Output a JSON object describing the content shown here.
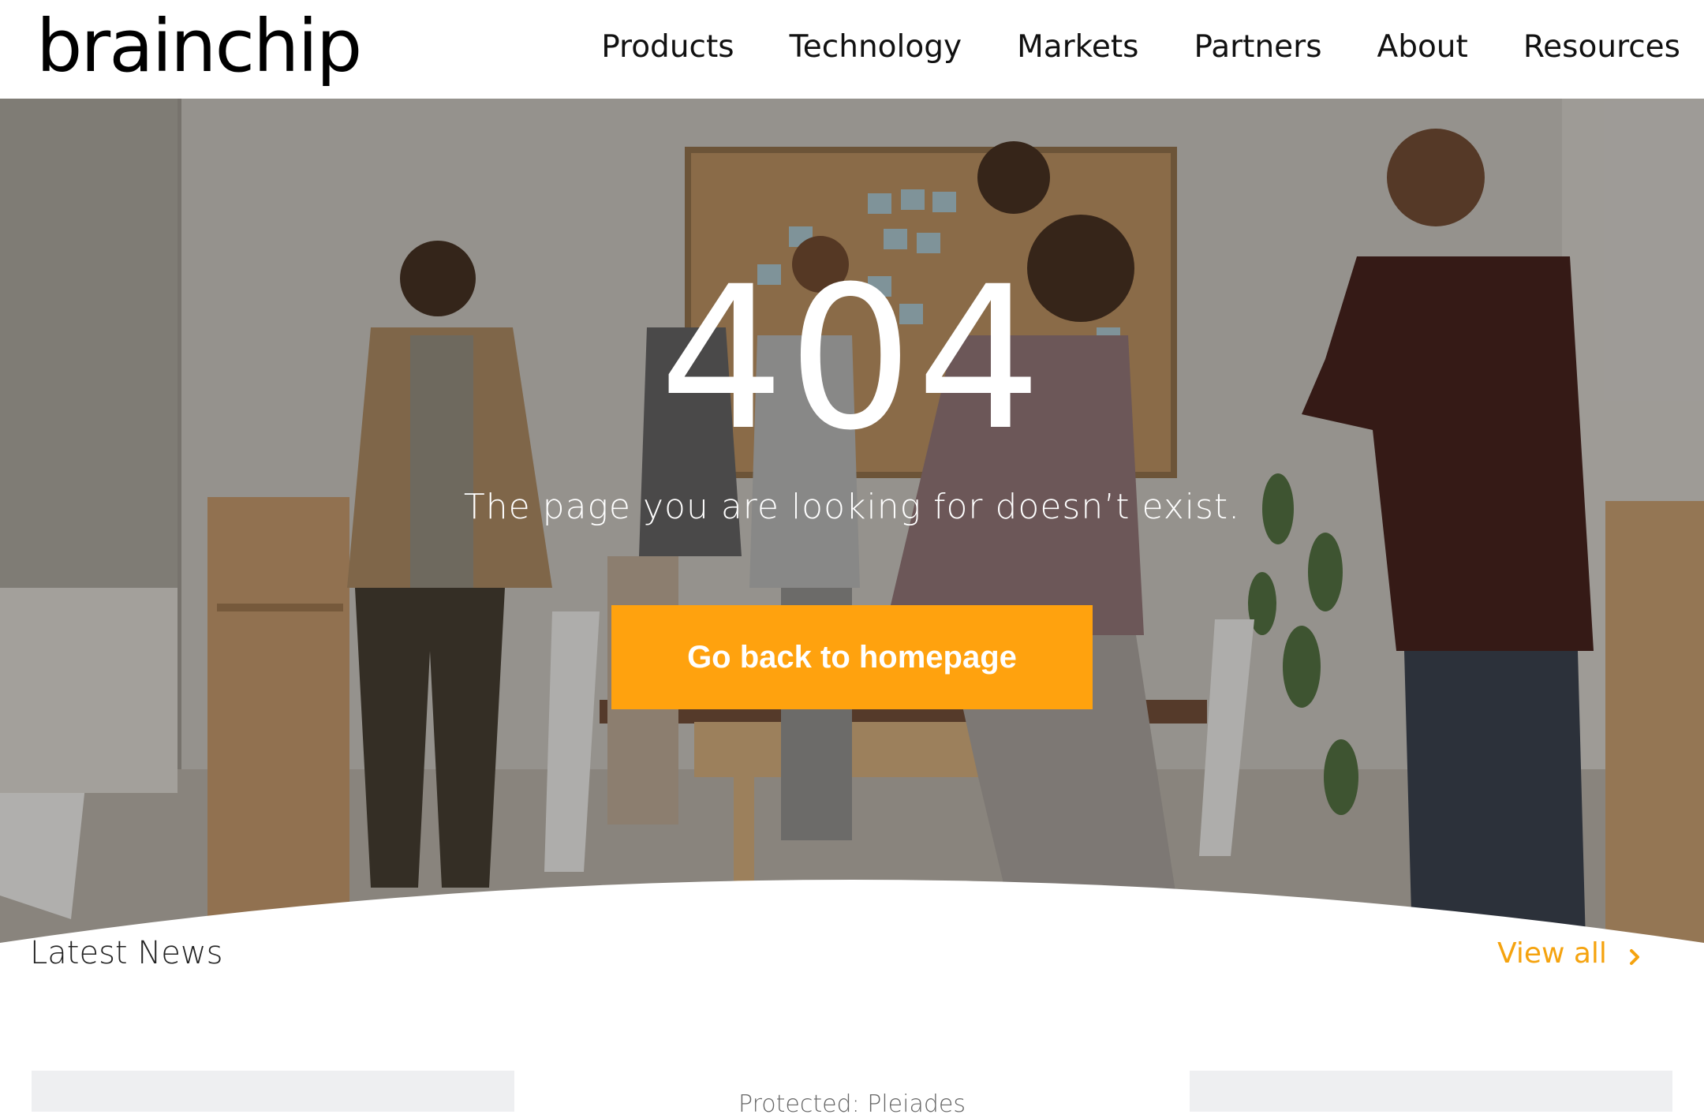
{
  "brand": {
    "logo_text": "brainchip"
  },
  "nav": {
    "items": [
      {
        "label": "Products"
      },
      {
        "label": "Technology"
      },
      {
        "label": "Markets"
      },
      {
        "label": "Partners"
      },
      {
        "label": "About"
      },
      {
        "label": "Resources"
      }
    ]
  },
  "hero": {
    "code": "404",
    "message": "The page you are looking for doesn’t exist.",
    "cta_label": "Go back to homepage"
  },
  "news": {
    "title": "Latest News",
    "view_all_label": "View all",
    "cards": [
      {
        "title": ""
      },
      {
        "title": "Protected: Pleiades"
      },
      {
        "title": ""
      }
    ]
  },
  "colors": {
    "accent": "#ffa20e",
    "link_accent": "#f5a30f",
    "card_bg": "#eeeff1"
  },
  "icons": {
    "view_all": "chevron-right-icon"
  }
}
